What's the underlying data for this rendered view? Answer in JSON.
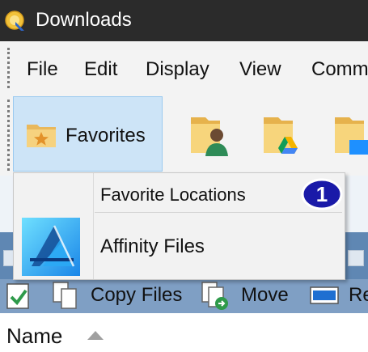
{
  "window": {
    "title": "Downloads",
    "app_icon": "app-logo-icon"
  },
  "menubar": {
    "items": [
      {
        "label": "File"
      },
      {
        "label": "Edit"
      },
      {
        "label": "Display"
      },
      {
        "label": "View"
      },
      {
        "label": "Comm"
      }
    ]
  },
  "toolbar": {
    "favorites_label": "Favorites",
    "icons": [
      "user-folder-icon",
      "google-drive-folder-icon",
      "blue-folder-icon"
    ]
  },
  "popup": {
    "header": "Favorite Locations",
    "badge": "1",
    "items": [
      {
        "label": "Affinity Files",
        "icon": "affinity-icon"
      }
    ]
  },
  "commands": {
    "copy_label": "Copy Files",
    "move_label": "Move",
    "rename_label": "Re"
  },
  "filelist": {
    "name_column": "Name",
    "sort": "ascending"
  },
  "colors": {
    "titlebar": "#2b2b2b",
    "favorites_highlight": "#cde4f7",
    "band_blue": "#5f87b3",
    "badge": "#1a1aa8"
  }
}
